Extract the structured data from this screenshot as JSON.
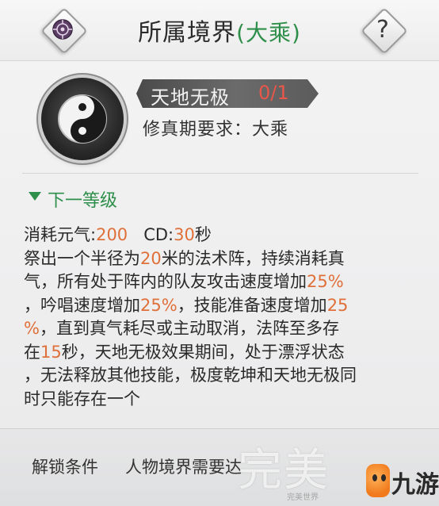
{
  "header": {
    "title": "所属境界",
    "realm": "(大乘)",
    "left_icon": "realm-emblem-icon",
    "help_label": "?"
  },
  "skill": {
    "icon": "yin-yang-icon",
    "name": "天地无极",
    "level": "0/1",
    "requirement": "修真期要求：大乘"
  },
  "next_level": {
    "label": "下一等级"
  },
  "description": {
    "line1": [
      "消耗元气:",
      "200",
      "   CD:",
      "30",
      "秒"
    ],
    "line2": [
      "祭出一个半径为",
      "20",
      "米的法术阵，持续消耗真"
    ],
    "line3": [
      "气，所有处于阵内的队友攻击速度增加",
      "25%"
    ],
    "line4": [
      "，吟唱速度增加",
      "25%",
      "，技能准备速度增加",
      "25"
    ],
    "line5": [
      "%",
      "，直到真气耗尽或主动取消，法阵至多存"
    ],
    "line6": [
      "在",
      "15",
      "秒，天地无极效果期间，处于漂浮状态"
    ],
    "line7": "，无法释放其他技能，极度乾坤和天地无极同",
    "line8": "时只能存在一个"
  },
  "unlock": {
    "label": "解锁条件",
    "value": "人物境界需要达"
  },
  "watermark": {
    "text": "完美",
    "sub": "完美世界",
    "logo_text": "九游"
  },
  "colors": {
    "accent_green": "#2e8f4a",
    "highlight_orange": "#e0703a",
    "level_red": "#e8574a"
  }
}
